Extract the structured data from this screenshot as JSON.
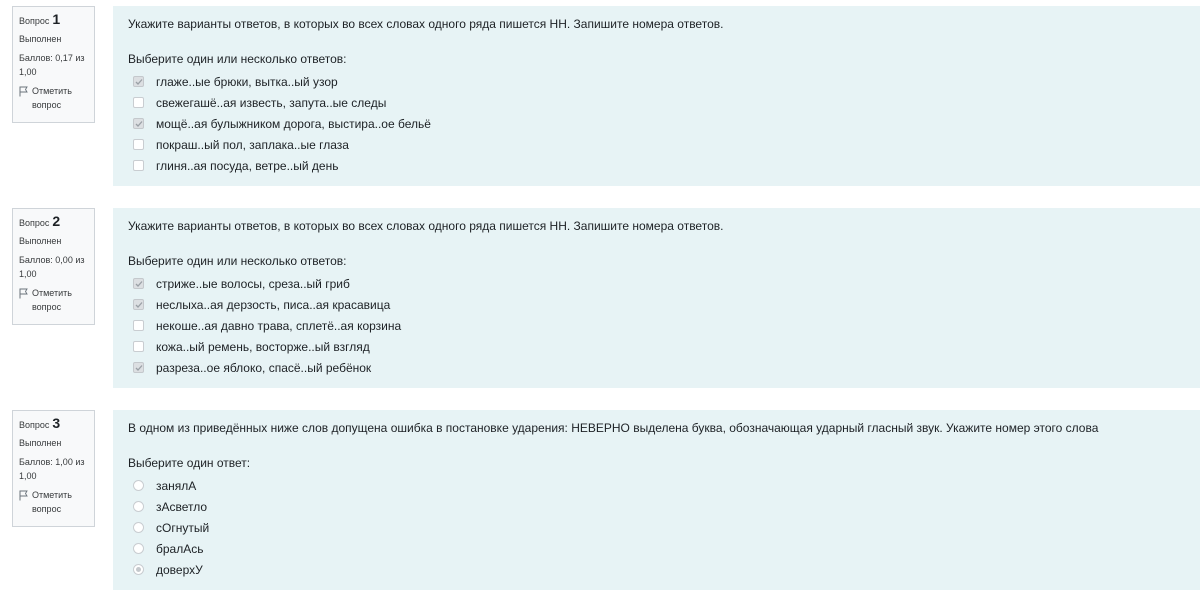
{
  "questions": [
    {
      "label": "Вопрос",
      "number": "1",
      "state": "Выполнен",
      "grade": "Баллов: 0,17 из 1,00",
      "flag": "Отметить вопрос",
      "text": "Укажите варианты ответов, в которых во всех словах одного ряда пишется НН. Запишите номера ответов.",
      "prompt": "Выберите один или несколько ответов:",
      "input_type": "checkbox",
      "options": [
        {
          "label": "глаже..ые брюки, вытка..ый узор",
          "checked": true
        },
        {
          "label": "свежегашё..ая известь, запута..ые следы",
          "checked": false
        },
        {
          "label": "мощё..ая булыжником дорога, выстира..ое бельё",
          "checked": true
        },
        {
          "label": "покраш..ый пол, заплака..ые глаза",
          "checked": false
        },
        {
          "label": "глиня..ая посуда, ветре..ый день",
          "checked": false
        }
      ]
    },
    {
      "label": "Вопрос",
      "number": "2",
      "state": "Выполнен",
      "grade": "Баллов: 0,00 из 1,00",
      "flag": "Отметить вопрос",
      "text": "Укажите варианты ответов, в которых во всех словах одного ряда пишется НН. Запишите номера ответов.",
      "prompt": "Выберите один или несколько ответов:",
      "input_type": "checkbox",
      "options": [
        {
          "label": "стриже..ые волосы, среза..ый гриб",
          "checked": true
        },
        {
          "label": "неслыха..ая дерзость, писа..ая красавица",
          "checked": true
        },
        {
          "label": "некоше..ая давно трава, сплетё..ая корзина",
          "checked": false
        },
        {
          "label": "кожа..ый ремень, восторже..ый взгляд",
          "checked": false
        },
        {
          "label": "разреза..ое яблоко, спасё..ый ребёнок",
          "checked": true
        }
      ]
    },
    {
      "label": "Вопрос",
      "number": "3",
      "state": "Выполнен",
      "grade": "Баллов: 1,00 из 1,00",
      "flag": "Отметить вопрос",
      "text": "В одном из приведённых ниже слов допущена ошибка в постановке ударения: НЕВЕРНО выделена буква, обозначающая ударный гласный звук. Укажите номер этого слова",
      "prompt": "Выберите один ответ:",
      "input_type": "radio",
      "options": [
        {
          "label": "занялА",
          "checked": false
        },
        {
          "label": "зАсветло",
          "checked": false
        },
        {
          "label": "сОгнутый",
          "checked": false
        },
        {
          "label": "бралАсь",
          "checked": false
        },
        {
          "label": "доверхУ",
          "checked": true
        }
      ]
    }
  ],
  "colors": {
    "content_bg": "#e7f3f5",
    "info_bg": "#f8f9fa",
    "info_border": "#cfd4d9",
    "text": "#1d2125"
  },
  "icons": {
    "flag": "flag-icon",
    "checkbox_checked": "check-icon"
  }
}
